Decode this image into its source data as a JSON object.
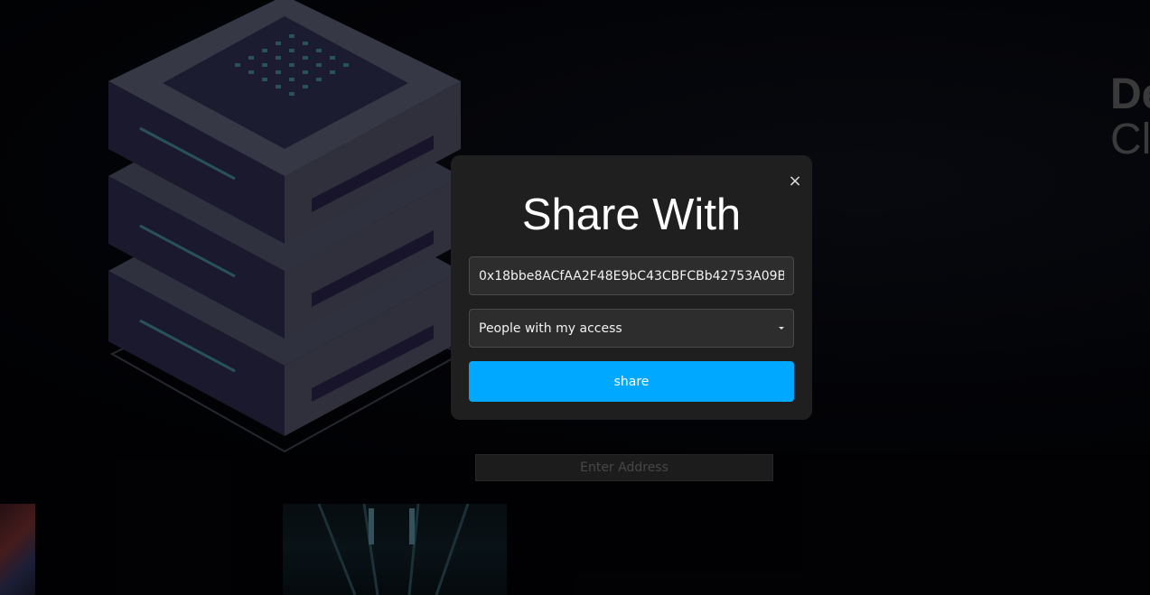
{
  "hero": {
    "title_line1": "De",
    "title_line2": "Cl"
  },
  "address_input": {
    "placeholder": "Enter Address",
    "value": ""
  },
  "modal": {
    "title": "Share With",
    "close_label": "×",
    "address_value": "0x18bbe8ACfAA2F48E9bC43CBFCBb42753A09B",
    "access_select": {
      "selected": "People with my access"
    },
    "share_label": "share"
  },
  "colors": {
    "accent": "#00a8ff",
    "modal_bg": "#1f1f1f",
    "page_bg": "#030307"
  },
  "icons": [
    "server-stack-illustration",
    "close-icon",
    "chevron-down-icon"
  ]
}
